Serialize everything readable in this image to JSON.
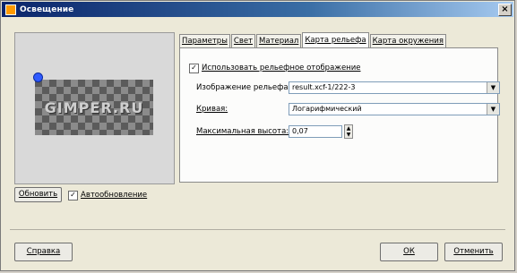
{
  "window": {
    "title": "Освещение",
    "close_glyph": "×"
  },
  "preview": {
    "watermark": "GIMPER.RU",
    "update_button": "Обновить",
    "auto_update_checked": true,
    "auto_update_label": "Автообновление",
    "checkmark": "✓"
  },
  "tabs": [
    {
      "label": "Параметры"
    },
    {
      "label": "Свет"
    },
    {
      "label": "Материал"
    },
    {
      "label": "Карта рельефа",
      "active": true
    },
    {
      "label": "Карта окружения"
    }
  ],
  "bump": {
    "enable_checked": true,
    "enable_label": "Использовать рельефное отображение",
    "image_label": "Изображение рельефа:",
    "image_value": "result.xcf-1/222-3",
    "curve_label": "Кривая:",
    "curve_value": "Логарифмический",
    "max_height_label": "Максимальная высота:",
    "max_height_value": "0,07",
    "dropdown_glyph": "▼",
    "spin_up": "▲",
    "spin_down": "▼"
  },
  "footer": {
    "help_button": "Справка",
    "ok_button": "ОК",
    "cancel_button": "Отменить"
  }
}
